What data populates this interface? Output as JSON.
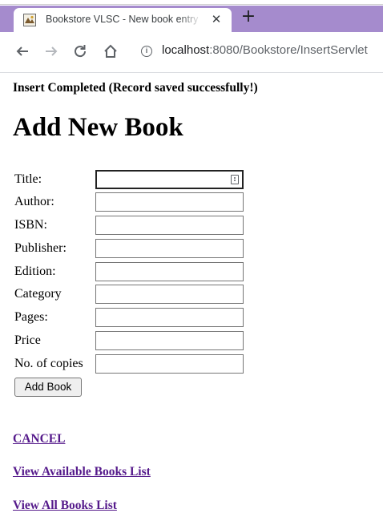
{
  "browser": {
    "tab_title": "Bookstore VLSC - New book entry",
    "tab_close": "✕",
    "new_tab": "+",
    "url_host": "localhost",
    "url_path": ":8080/Bookstore/InsertServlet",
    "icons": {
      "back": "back-arrow-icon",
      "forward": "forward-arrow-icon",
      "reload": "reload-icon",
      "home": "home-icon",
      "info": "info-icon",
      "favicon": "bookstore-favicon"
    },
    "tabstrip_color": "#a58bcd"
  },
  "page": {
    "status_message": "Insert Completed (Record saved successfully!)",
    "heading": "Add New Book",
    "form": {
      "fields": [
        {
          "label": "Title:",
          "value": ""
        },
        {
          "label": "Author:",
          "value": ""
        },
        {
          "label": "ISBN:",
          "value": ""
        },
        {
          "label": "Publisher:",
          "value": ""
        },
        {
          "label": "Edition:",
          "value": ""
        },
        {
          "label": "Category",
          "value": ""
        },
        {
          "label": "Pages:",
          "value": ""
        },
        {
          "label": "Price",
          "value": ""
        },
        {
          "label": "No. of copies",
          "value": ""
        }
      ],
      "submit_label": "Add Book"
    },
    "links": {
      "cancel": "CANCEL",
      "available_books": "View Available Books List",
      "all_books": "View All Books List"
    },
    "link_color": "#551a8b"
  }
}
